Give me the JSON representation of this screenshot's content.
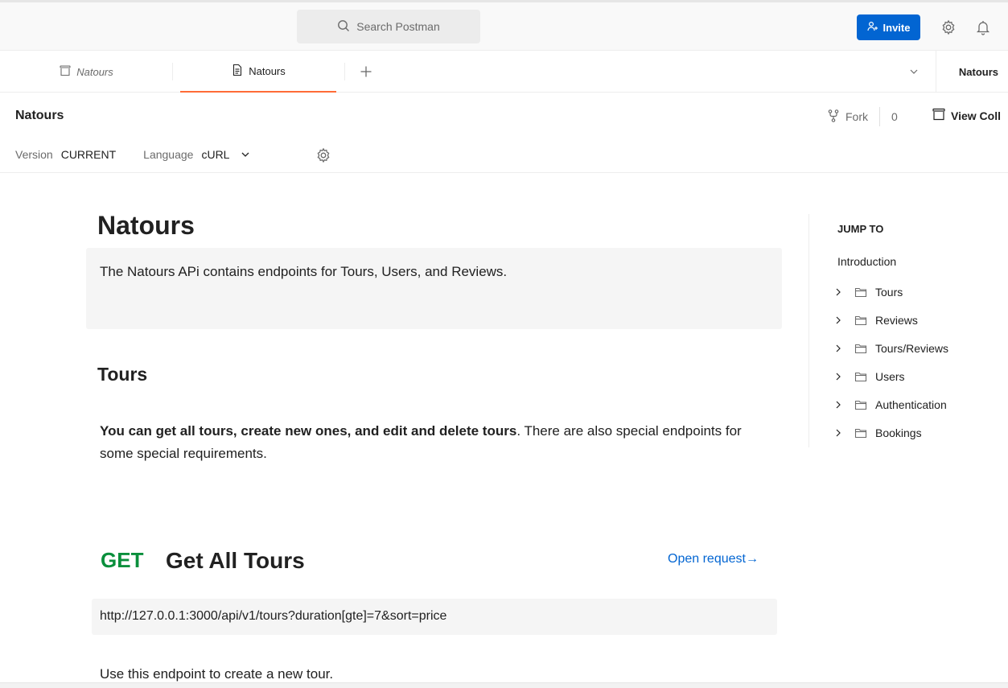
{
  "header": {
    "search_placeholder": "Search Postman",
    "invite_label": "Invite"
  },
  "tabs": [
    {
      "label": "Natours",
      "style": "italic",
      "icon": "collection-icon"
    },
    {
      "label": "Natours",
      "style": "active",
      "icon": "document-icon"
    }
  ],
  "environment": {
    "label": "Natours"
  },
  "collection": {
    "title": "Natours",
    "fork_label": "Fork",
    "fork_count": "0",
    "view_collection_label": "View Coll"
  },
  "meta": {
    "version_label": "Version",
    "version_value": "CURRENT",
    "language_label": "Language",
    "language_value": "cURL"
  },
  "doc": {
    "title": "Natours",
    "description": "The Natours APi contains endpoints for Tours, Users, and Reviews.",
    "section_title": "Tours",
    "section_desc_bold": "You can get all tours, create new ones, and edit and delete tours",
    "section_desc_rest": ". There are also special endpoints for some special requirements.",
    "request": {
      "method": "GET",
      "name": "Get All Tours",
      "open_label": "Open request→",
      "url": "http://127.0.0.1:3000/api/v1/tours?duration[gte]=7&sort=price",
      "description": "Use this endpoint to create a new tour."
    }
  },
  "jump_to": {
    "title": "JUMP TO",
    "intro": "Introduction",
    "items": [
      "Tours",
      "Reviews",
      "Tours/Reviews",
      "Users",
      "Authentication",
      "Bookings"
    ]
  },
  "colors": {
    "accent": "#0265d2",
    "get_method": "#0a8f3c",
    "active_tab": "#ff6c37"
  }
}
